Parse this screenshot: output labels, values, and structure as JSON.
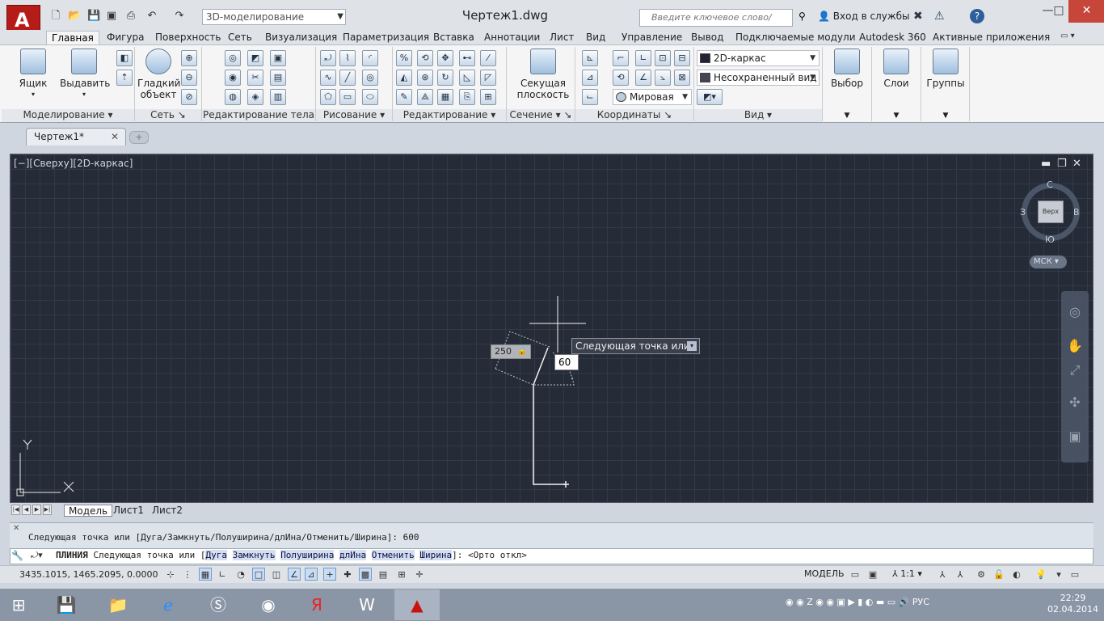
{
  "title_bar": {
    "app_logo": "A",
    "workspace": "3D-моделирование",
    "doc_title": "Чертеж1.dwg",
    "search_placeholder": "Введите ключевое слово/фразу",
    "sign_in": "Вход в службы",
    "help": "?"
  },
  "menu_tabs": [
    "Главная",
    "Фигура",
    "Поверхность",
    "Сеть",
    "Визуализация",
    "Параметризация",
    "Вставка",
    "Аннотации",
    "Лист",
    "Вид",
    "Управление",
    "Вывод",
    "Подключаемые модули",
    "Autodesk 360",
    "Активные приложения"
  ],
  "ribbon": {
    "box_label": "Ящик",
    "extrude_label": "Выдавить",
    "smooth_label": "Гладкий объект",
    "section_plane_label": "Секущая плоскость",
    "select_label": "Выбор",
    "layers_label": "Слои",
    "groups_label": "Группы",
    "visual_style": "2D-каркас",
    "named_view": "Несохраненный вид",
    "ucs_name": "Мировая",
    "panels": [
      "Моделирование",
      "Сеть",
      "Редактирование тела",
      "Рисование",
      "Редактирование",
      "Сечение",
      "Координаты",
      "Вид"
    ]
  },
  "file_tabs": {
    "active": "Чертеж1*",
    "new": "+"
  },
  "viewport": {
    "label": "[−][Сверху][2D-каркас]",
    "compass": {
      "north": "С",
      "south": "Ю",
      "west": "З",
      "east": "В",
      "face": "Верх"
    },
    "wcs_badge": "МСК",
    "ucs": {
      "x": "X",
      "y": "Y"
    }
  },
  "drawing": {
    "dim_length": "250",
    "tooltip": "Следующая точка или",
    "angle_value": "60"
  },
  "layout_tabs": [
    "Модель",
    "Лист1",
    "Лист2"
  ],
  "command": {
    "history": "Следующая точка или [Дуга/Замкнуть/Полуширина/длИна/Отменить/Ширина]: 600",
    "command_name": "ПЛИНИЯ",
    "prompt": "Следующая точка или [",
    "options": [
      "Дуга",
      "Замкнуть",
      "Полуширина",
      "длИна",
      "Отменить",
      "Ширина"
    ],
    "tail": "]:  <Орто откл>"
  },
  "status_bar": {
    "coords": "3435.1015, 1465.2095, 0.0000",
    "model": "МОДЕЛЬ",
    "scale": "1:1"
  },
  "taskbar": {
    "time": "22:29",
    "date": "02.04.2014",
    "lang": "РУС"
  }
}
